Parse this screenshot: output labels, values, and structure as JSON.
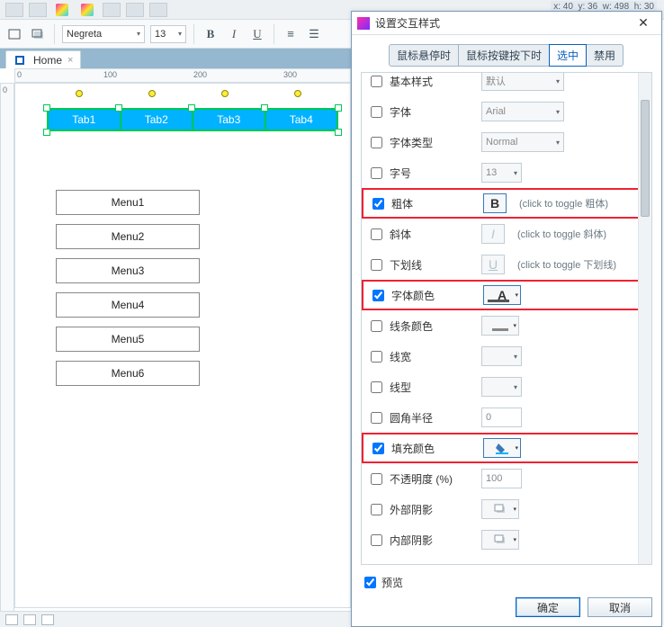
{
  "coords": {
    "x_label": "x:",
    "x": "40",
    "y_label": "y:",
    "y": "36",
    "w_label": "w:",
    "w": "498",
    "h_label": "h:",
    "h": "30"
  },
  "toolbar": {
    "font_name": "Negreta",
    "font_size": "13",
    "bold": "B",
    "italic": "I",
    "underline": "U"
  },
  "doctab": {
    "label": "Home",
    "close": "×"
  },
  "ruler": {
    "marks": [
      "0",
      "100",
      "200",
      "300"
    ]
  },
  "canvas": {
    "tabs": [
      "Tab1",
      "Tab2",
      "Tab3",
      "Tab4"
    ],
    "menus": [
      "Menu1",
      "Menu2",
      "Menu3",
      "Menu4",
      "Menu5",
      "Menu6"
    ]
  },
  "dialog": {
    "title": "设置交互样式",
    "tabs": [
      "鼠标悬停时",
      "鼠标按键按下时",
      "选中",
      "禁用"
    ],
    "active_tab_index": 2,
    "props": [
      {
        "key": "base",
        "label": "基本样式",
        "ctl": "combo",
        "value": "默认",
        "checked": false
      },
      {
        "key": "font",
        "label": "字体",
        "ctl": "combo",
        "value": "Arial",
        "checked": false
      },
      {
        "key": "ftype",
        "label": "字体类型",
        "ctl": "combo",
        "value": "Normal",
        "checked": false
      },
      {
        "key": "fsize",
        "label": "字号",
        "ctl": "combo-sm",
        "value": "13",
        "checked": false
      },
      {
        "key": "bold",
        "label": "粗体",
        "ctl": "btn-B",
        "hint": "(click to toggle 粗体)",
        "checked": true,
        "highlight": true
      },
      {
        "key": "italic",
        "label": "斜体",
        "ctl": "btn-I",
        "hint": "(click to toggle 斜体)",
        "checked": false
      },
      {
        "key": "uline",
        "label": "下划线",
        "ctl": "btn-U",
        "hint": "(click to toggle 下划线)",
        "checked": false
      },
      {
        "key": "fcolor",
        "label": "字体颜色",
        "ctl": "btn-A-color",
        "checked": true,
        "highlight": true
      },
      {
        "key": "lcolor",
        "label": "线条颜色",
        "ctl": "btn-line-color",
        "checked": false
      },
      {
        "key": "lwidth",
        "label": "线宽",
        "ctl": "combo-sm",
        "value": "",
        "checked": false
      },
      {
        "key": "ltype",
        "label": "线型",
        "ctl": "combo-sm",
        "value": "",
        "checked": false
      },
      {
        "key": "radius",
        "label": "圆角半径",
        "ctl": "num",
        "value": "0",
        "checked": false
      },
      {
        "key": "fill",
        "label": "填充颜色",
        "ctl": "btn-fill",
        "checked": true,
        "highlight": true
      },
      {
        "key": "opac",
        "label": "不透明度 (%)",
        "ctl": "num",
        "value": "100",
        "checked": false
      },
      {
        "key": "oshad",
        "label": "外部阴影",
        "ctl": "btn-shadow",
        "checked": false
      },
      {
        "key": "ishad",
        "label": "内部阴影",
        "ctl": "btn-shadow",
        "checked": false
      }
    ],
    "preview_label": "预览",
    "ok": "确定",
    "cancel": "取消"
  }
}
